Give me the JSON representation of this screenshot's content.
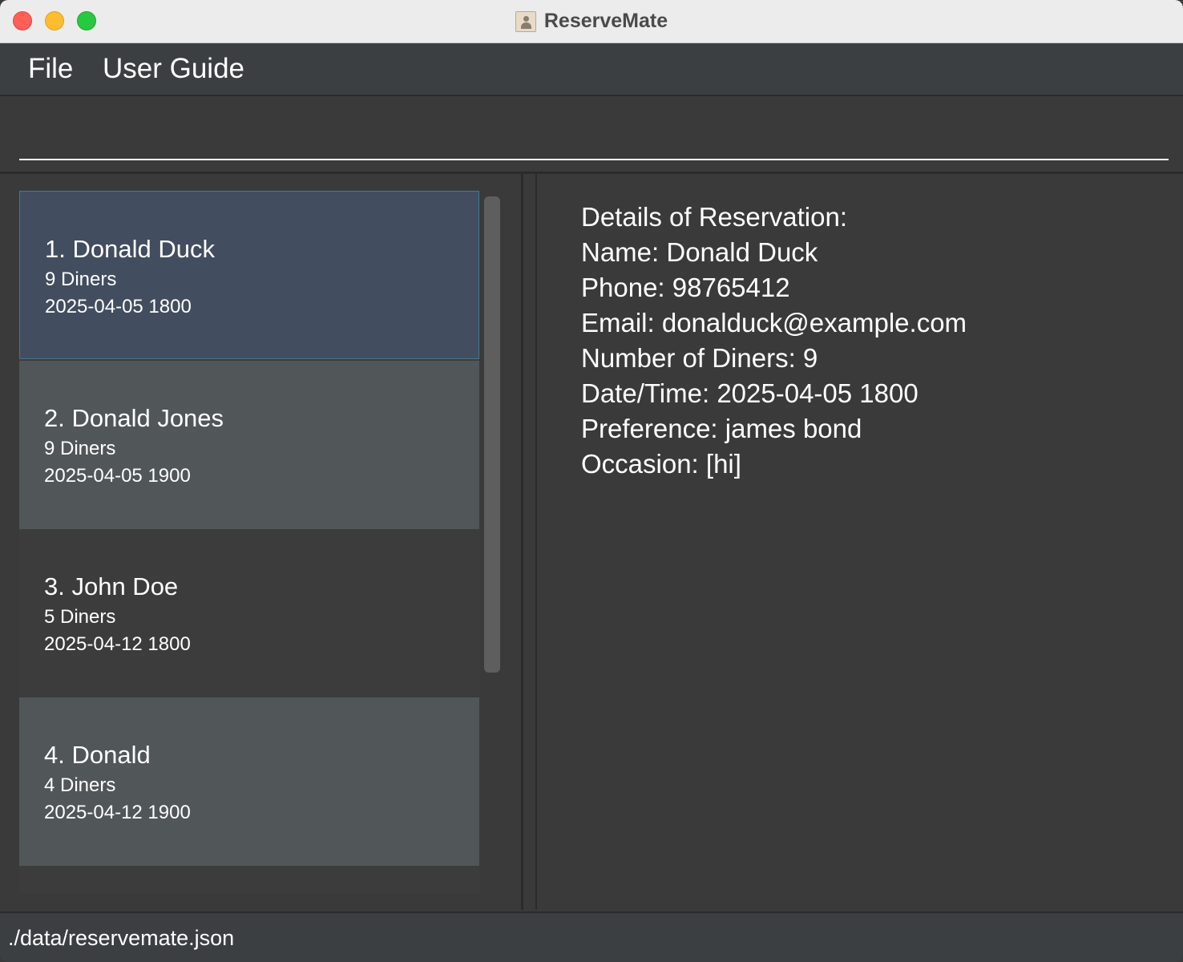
{
  "window": {
    "title": "ReserveMate",
    "icon": "contact-card-icon"
  },
  "menu": {
    "file": "File",
    "user_guide": "User Guide"
  },
  "command_box": {
    "value": "",
    "placeholder": ""
  },
  "reservations": [
    {
      "name": "1. Donald Duck",
      "diners": "9 Diners",
      "datetime": "2025-04-05 1800",
      "selected": true
    },
    {
      "name": "2. Donald Jones",
      "diners": "9 Diners",
      "datetime": "2025-04-05 1900",
      "selected": false
    },
    {
      "name": "3. John Doe",
      "diners": "5 Diners",
      "datetime": "2025-04-12 1800",
      "selected": false
    },
    {
      "name": "4. Donald",
      "diners": "4 Diners",
      "datetime": "2025-04-12 1900",
      "selected": false
    }
  ],
  "details": {
    "heading": "Details of Reservation:",
    "name": "Name: Donald Duck",
    "phone": "Phone: 98765412",
    "email": "Email: donalduck@example.com",
    "diners": "Number of Diners: 9",
    "datetime": "Date/Time: 2025-04-05 1800",
    "preference": "Preference: james bond",
    "occasion": "Occasion: [hi]"
  },
  "status": {
    "file_path": "./data/reservemate.json"
  },
  "colors": {
    "background": "#3a3a3a",
    "selected_card": "#424d5f",
    "alt_card": "#515658",
    "selected_border": "#3e7b91"
  }
}
